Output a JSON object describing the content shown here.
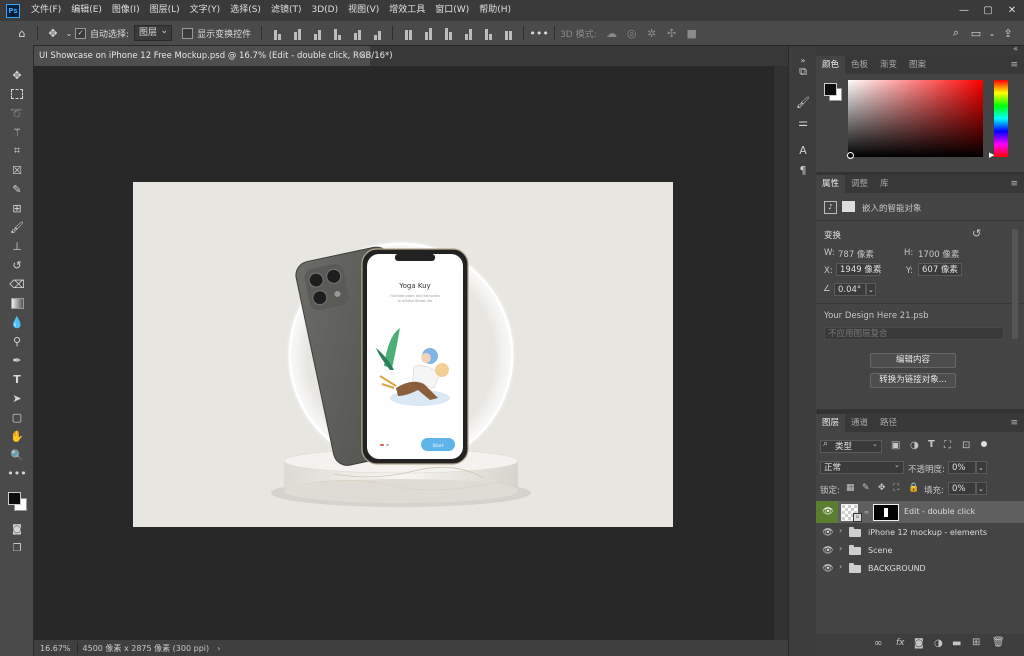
{
  "app": {
    "logo": "Ps"
  },
  "menu": [
    "文件(F)",
    "编辑(E)",
    "图像(I)",
    "图层(L)",
    "文字(Y)",
    "选择(S)",
    "滤镜(T)",
    "3D(D)",
    "视图(V)",
    "增效工具",
    "窗口(W)",
    "帮助(H)"
  ],
  "window_controls": {
    "minimize": "—",
    "maximize": "▢",
    "close": "✕"
  },
  "options": {
    "auto_select_label": "自动选择:",
    "auto_select_value": "图层",
    "show_transform_label": "显示变换控件",
    "mode_3d_label": "3D 模式:"
  },
  "document": {
    "tab_title": "UI Showcase on iPhone 12 Free Mockup.psd @ 16.7% (Edit - double click, RGB/16*)",
    "tab_close": "×",
    "screen_title": "Yoga Kuy",
    "screen_subtitle_1": "Find best poses and instructors",
    "screen_subtitle_2": "to achieve fitness like",
    "screen_button": "Start"
  },
  "status": {
    "zoom": "16.67%",
    "doc_info": "4500 像素 x 2875 像素 (300 ppi)",
    "arrow": "›"
  },
  "color_panel": {
    "tabs": [
      "颜色",
      "色板",
      "渐变",
      "图案"
    ],
    "foreground": "#0d0d0d",
    "background": "#ffffff"
  },
  "props_panel": {
    "tabs": [
      "属性",
      "调整",
      "库"
    ],
    "smart_object_label": "嵌入的智能对象",
    "section_transform": "变换",
    "w_label": "W:",
    "w_value": "787 像素",
    "h_label": "H:",
    "h_value": "1700 像素",
    "x_label": "X:",
    "x_value": "1949 像素",
    "y_label": "Y:",
    "y_value": "607 像素",
    "angle_value": "0.04°",
    "linked_file": "Your Design Here 21.psb",
    "comp_placeholder": "不应用图层复合",
    "edit_button": "编辑内容",
    "convert_button": "转换为链接对象..."
  },
  "layers_panel": {
    "tabs": [
      "图层",
      "通道",
      "路径"
    ],
    "filter_label": "类型",
    "blend_mode": "正常",
    "opacity_label": "不透明度:",
    "opacity_value": "0%",
    "lock_label": "锁定:",
    "fill_label": "填充:",
    "fill_value": "0%",
    "layers": [
      {
        "name": "Edit - double click",
        "type": "smart"
      },
      {
        "name": "iPhone 12 mockup - elements",
        "type": "group"
      },
      {
        "name": "Scene",
        "type": "group"
      },
      {
        "name": "BACKGROUND",
        "type": "group"
      }
    ],
    "footer_icons": [
      "link-icon",
      "fx-icon",
      "mask-icon",
      "adjustment-icon",
      "group-icon",
      "new-layer-icon",
      "trash-icon"
    ],
    "footer_fx": "fx"
  }
}
